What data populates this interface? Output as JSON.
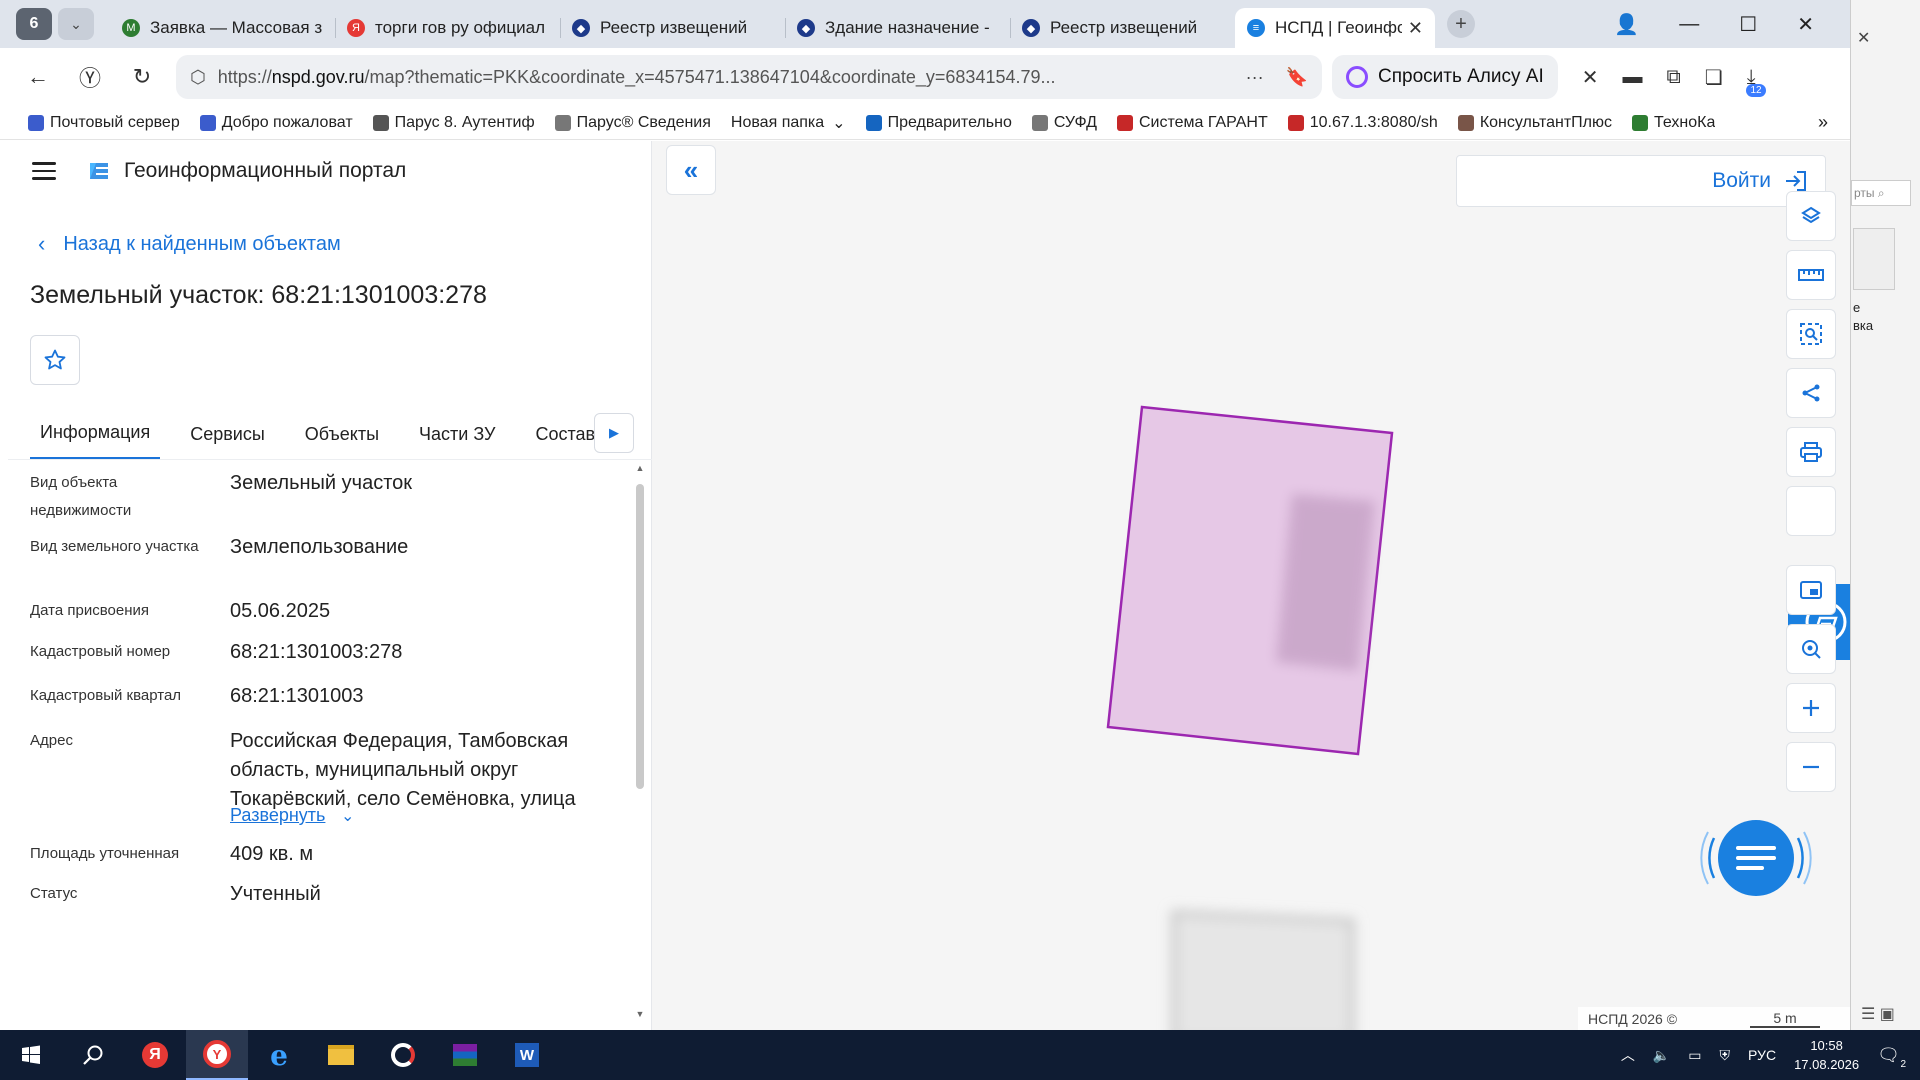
{
  "browser": {
    "tab_counter": "6",
    "tabs": [
      {
        "label": "Заявка — Массовая з",
        "icon_color": "#2e7d32",
        "icon_glyph": "M"
      },
      {
        "label": "торги гов ру официал",
        "icon_color": "#e53935",
        "icon_glyph": "Я"
      },
      {
        "label": "Реестр извещений",
        "icon_color": "#1e3a8a",
        "icon_glyph": "◆"
      },
      {
        "label": "Здание назначение -",
        "icon_color": "#1e3a8a",
        "icon_glyph": "◆"
      },
      {
        "label": "Реестр извещений",
        "icon_color": "#1e3a8a",
        "icon_glyph": "◆"
      },
      {
        "label": "НСПД | Геоинформ",
        "icon_color": "#1a80e0",
        "icon_glyph": "≡",
        "active": true
      }
    ],
    "url_scheme": "https://",
    "url_host": "nspd.gov.ru",
    "url_rest": "/map?thematic=PKK&coordinate_x=4575471.138647104&coordinate_y=6834154.79...",
    "alice_label": "Спросить Алису AI",
    "extension_badge": "12",
    "bookmarks": [
      {
        "label": "Почтовый сервер",
        "icon_color": "#3b5ccc"
      },
      {
        "label": "Добро пожаловат",
        "icon_color": "#3b5ccc"
      },
      {
        "label": "Парус 8. Аутентиф",
        "icon_color": "#555555"
      },
      {
        "label": "Парус® Сведения",
        "icon_color": "#777777"
      },
      {
        "label": "Новая папка",
        "icon_color": "",
        "dropdown": "⌄"
      },
      {
        "label": "Предварительно",
        "icon_color": "#1565c0"
      },
      {
        "label": "СУФД",
        "icon_color": "#777777"
      },
      {
        "label": "Система ГАРАНТ",
        "icon_color": "#c62828"
      },
      {
        "label": "10.67.1.3:8080/sh",
        "icon_color": "#c62828"
      },
      {
        "label": "КонсультантПлюс",
        "icon_color": "#795548"
      },
      {
        "label": "ТехноКа",
        "icon_color": "#2e7d32"
      }
    ],
    "bookmarks_more": "»"
  },
  "portal": {
    "title": "Геоинформационный портал",
    "back_label": "Назад к найденным объектам",
    "object_title": "Земельный участок: 68:21:1301003:278",
    "tabs": [
      "Информация",
      "Сервисы",
      "Объекты",
      "Части ЗУ",
      "Состав"
    ],
    "properties": [
      {
        "key": "Вид объекта недвижимости",
        "value": "Земельный участок"
      },
      {
        "key": "Вид земельного участка",
        "value": "Землепользование"
      },
      {
        "key": "Дата присвоения",
        "value": "05.06.2025"
      },
      {
        "key": "Кадастровый номер",
        "value": "68:21:1301003:278"
      },
      {
        "key": "Кадастровый квартал",
        "value": "68:21:1301003"
      },
      {
        "key": "Адрес",
        "value": "Российская Федерация, Тамбовская область, муниципальный округ Токарёвский, село Семёновка, улица"
      },
      {
        "key": "Площадь уточненная",
        "value": "409 кв. м"
      },
      {
        "key": "Статус",
        "value": "Учтенный"
      }
    ],
    "expand_label": "Развернуть"
  },
  "map": {
    "login_label": "Войти",
    "attribution": "НСПД 2026 ©",
    "scale_label": "5 m",
    "parcel_fill": "#e6c8e6",
    "parcel_stroke": "#9c27b0"
  },
  "backwin": {
    "search_hint": "рты",
    "caption_1": "е",
    "caption_2": "вка"
  },
  "taskbar": {
    "lang": "РУС",
    "time": "10:58",
    "date": "17.08.2026",
    "notifications": "2"
  }
}
